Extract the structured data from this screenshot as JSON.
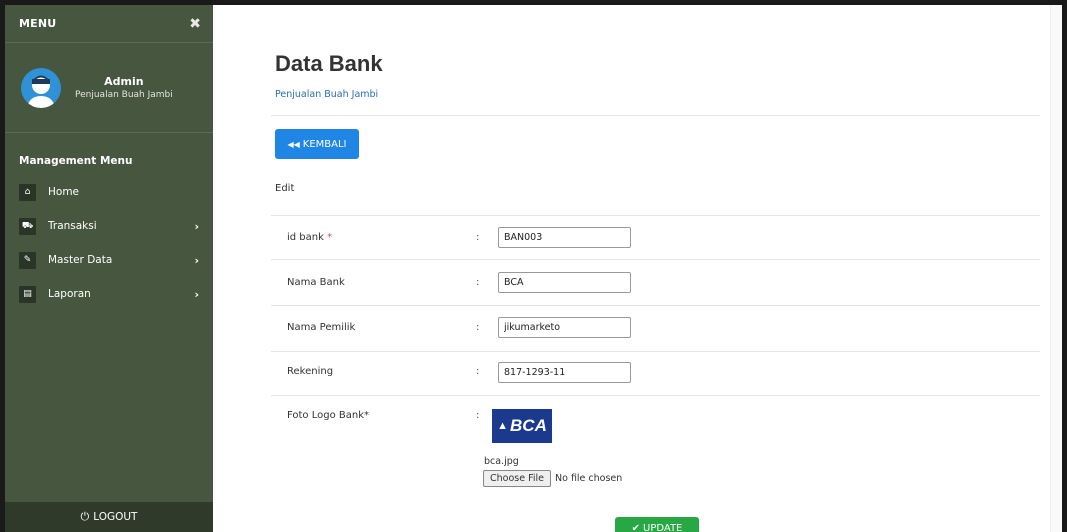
{
  "sidebar": {
    "menu_title": "MENU",
    "close_glyph": "✖",
    "user": {
      "name": "Admin",
      "subtitle": "Penjualan Buah Jambi"
    },
    "section_title": "Management Menu",
    "items": [
      {
        "label": "Home",
        "icon": "home-icon",
        "glyph": "⌂",
        "has_chevron": false
      },
      {
        "label": "Transaksi",
        "icon": "cart-icon",
        "glyph": "⛟",
        "has_chevron": true
      },
      {
        "label": "Master Data",
        "icon": "edit-icon",
        "glyph": "✎",
        "has_chevron": true
      },
      {
        "label": "Laporan",
        "icon": "calendar-icon",
        "glyph": "▤",
        "has_chevron": true
      }
    ],
    "chevron": "›",
    "logout_label": "LOGOUT",
    "logout_glyph": "⏻"
  },
  "main": {
    "title": "Data Bank",
    "subtitle": "Penjualan Buah Jambi",
    "back_button": {
      "glyph": "◀◀",
      "label": "KEMBALI"
    },
    "section_label": "Edit",
    "fields": [
      {
        "label": "id bank",
        "required": "*",
        "value": "BAN003"
      },
      {
        "label": "Nama Bank",
        "required": "",
        "value": "BCA"
      },
      {
        "label": "Nama Pemilik",
        "required": "",
        "value": "jikumarketo"
      },
      {
        "label": "Rekening",
        "required": "",
        "value": "817-1293-11"
      }
    ],
    "logo_field": {
      "label": "Foto Logo Bank*",
      "logo_text": "BCA",
      "file_name": "bca.jpg",
      "choose_button": "Choose File",
      "no_file_text": "No file chosen"
    },
    "colon": ":",
    "update_button": {
      "glyph": "✔",
      "label": "UPDATE"
    }
  },
  "colors": {
    "sidebar_bg": "#47563f",
    "primary": "#1f86e6",
    "success": "#28a745",
    "logo_bg": "#1b3a8f"
  }
}
